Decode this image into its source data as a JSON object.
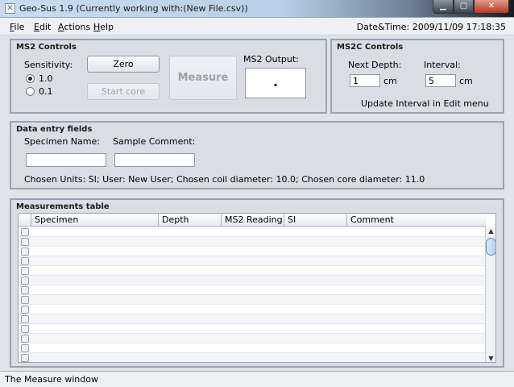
{
  "window": {
    "title": "Geo-Sus 1.9 (Currently working with:(New File.csv))",
    "icon": "app-icon"
  },
  "menubar": {
    "items": [
      {
        "label": "ile",
        "mnemonic": "F"
      },
      {
        "label": "dit",
        "mnemonic": "E"
      },
      {
        "label": "ctions",
        "mnemonic": "A"
      },
      {
        "label": "elp",
        "mnemonic": "H"
      }
    ],
    "datetime": "Date&Time: 2009/11/09 17:18:35"
  },
  "ms2": {
    "title": "MS2 Controls",
    "sensitivity_label": "Sensitivity:",
    "options": [
      {
        "label": "1.0",
        "selected": true
      },
      {
        "label": "0.1",
        "selected": false
      }
    ],
    "zero_button": "Zero",
    "start_core_button": "Start core",
    "measure_button": "Measure",
    "output_label": "MS2 Output:",
    "output_value": "."
  },
  "ms2c": {
    "title": "MS2C Controls",
    "next_depth_label": "Next Depth:",
    "next_depth_value": "1",
    "interval_label": "Interval:",
    "interval_value": "5",
    "unit": "cm",
    "note": "Update Interval in Edit menu"
  },
  "data_entry": {
    "title": "Data entry fields",
    "specimen_label": "Specimen Name:",
    "specimen_value": "",
    "comment_label": "Sample Comment:",
    "comment_value": "",
    "summary": "Chosen Units: SI;  User: New User;  Chosen coil diameter: 10.0;  Chosen core diameter: 11.0"
  },
  "table": {
    "title": "Measurements table",
    "columns": [
      "Specimen",
      "Depth",
      "MS2 Reading",
      "SI",
      "Comment"
    ],
    "row_count": 14
  },
  "status": {
    "text": "The Measure window"
  }
}
